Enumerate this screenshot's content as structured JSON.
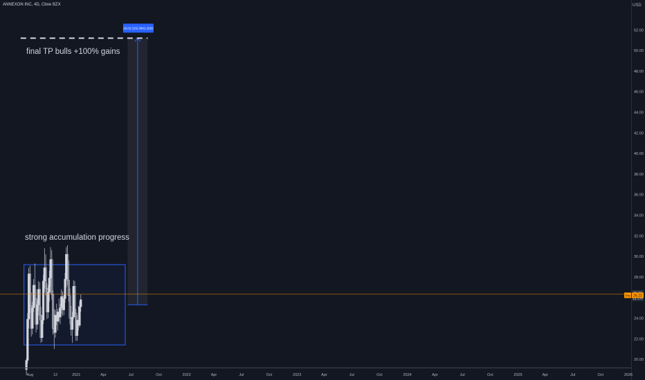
{
  "header": {
    "symbol_title": "ANNEXON INC, 4D, Cboe BZX",
    "currency": "USD"
  },
  "colors": {
    "background": "#131722",
    "candle": "#d1d4dc",
    "box_border": "#2962ff",
    "price_line": "#ff9800",
    "measure_fill": "rgba(120,123,134,0.15)",
    "measure_line": "#2962ff",
    "label_bg": "#2962ff",
    "target_line": "#d1d4dc"
  },
  "chart_data": {
    "type": "candlestick",
    "title": "",
    "xlabel": "",
    "ylabel": "",
    "x_ticks": [
      "Aug",
      "12",
      "2021",
      "Apr",
      "Jul",
      "Oct",
      "2022",
      "Apr",
      "Jul",
      "Oct",
      "2023",
      "Apr",
      "Jul",
      "Oct",
      "2024",
      "Apr",
      "Jul",
      "Oct",
      "2025",
      "Apr",
      "Jul",
      "Oct",
      "2026"
    ],
    "y_ticks": [
      20.0,
      22.0,
      24.0,
      26.0,
      28.0,
      30.0,
      32.0,
      34.0,
      36.0,
      38.0,
      40.0,
      42.0,
      44.0,
      46.0,
      48.0,
      50.0,
      52.0
    ],
    "ylim": [
      19.2,
      53.7
    ],
    "grid": false,
    "candles": [
      {
        "date": "2020-07-20",
        "o": 19.0,
        "h": 20.1,
        "l": 18.5,
        "c": 19.9
      },
      {
        "date": "2020-07-24",
        "o": 19.9,
        "h": 24.5,
        "l": 19.6,
        "c": 23.9
      },
      {
        "date": "2020-07-28",
        "o": 23.9,
        "h": 28.9,
        "l": 23.0,
        "c": 28.3
      },
      {
        "date": "2020-08-01",
        "o": 28.3,
        "h": 29.1,
        "l": 24.5,
        "c": 25.2
      },
      {
        "date": "2020-08-05",
        "o": 25.2,
        "h": 26.5,
        "l": 22.2,
        "c": 23.0
      },
      {
        "date": "2020-08-09",
        "o": 23.0,
        "h": 25.6,
        "l": 22.4,
        "c": 25.0
      },
      {
        "date": "2020-08-13",
        "o": 25.0,
        "h": 27.8,
        "l": 24.6,
        "c": 27.2
      },
      {
        "date": "2020-08-17",
        "o": 27.2,
        "h": 29.3,
        "l": 25.2,
        "c": 25.9
      },
      {
        "date": "2020-08-21",
        "o": 25.9,
        "h": 26.8,
        "l": 22.6,
        "c": 23.4
      },
      {
        "date": "2020-08-25",
        "o": 23.4,
        "h": 25.7,
        "l": 22.9,
        "c": 25.3
      },
      {
        "date": "2020-08-29",
        "o": 25.3,
        "h": 27.6,
        "l": 24.7,
        "c": 26.8
      },
      {
        "date": "2020-09-02",
        "o": 26.8,
        "h": 27.5,
        "l": 23.8,
        "c": 24.3
      },
      {
        "date": "2020-09-06",
        "o": 24.3,
        "h": 25.1,
        "l": 21.6,
        "c": 22.1
      },
      {
        "date": "2020-09-10",
        "o": 22.1,
        "h": 24.3,
        "l": 21.7,
        "c": 23.8
      },
      {
        "date": "2020-09-14",
        "o": 23.8,
        "h": 28.2,
        "l": 23.4,
        "c": 27.6
      },
      {
        "date": "2020-09-18",
        "o": 27.6,
        "h": 30.8,
        "l": 26.5,
        "c": 28.9
      },
      {
        "date": "2020-09-22",
        "o": 28.9,
        "h": 30.2,
        "l": 26.2,
        "c": 26.9
      },
      {
        "date": "2020-09-26",
        "o": 26.9,
        "h": 27.4,
        "l": 23.9,
        "c": 24.6
      },
      {
        "date": "2020-09-30",
        "o": 24.6,
        "h": 27.2,
        "l": 24.0,
        "c": 26.5
      },
      {
        "date": "2020-10-04",
        "o": 26.5,
        "h": 28.6,
        "l": 25.6,
        "c": 27.9
      },
      {
        "date": "2020-10-08",
        "o": 27.9,
        "h": 30.9,
        "l": 27.1,
        "c": 29.7
      },
      {
        "date": "2020-10-12",
        "o": 29.7,
        "h": 30.6,
        "l": 25.8,
        "c": 26.3
      },
      {
        "date": "2020-10-16",
        "o": 26.3,
        "h": 26.7,
        "l": 22.4,
        "c": 23.0
      },
      {
        "date": "2020-10-20",
        "o": 23.0,
        "h": 24.9,
        "l": 21.0,
        "c": 22.6
      },
      {
        "date": "2020-10-24",
        "o": 22.6,
        "h": 24.8,
        "l": 22.1,
        "c": 24.3
      },
      {
        "date": "2020-10-28",
        "o": 24.3,
        "h": 25.4,
        "l": 23.3,
        "c": 23.7
      },
      {
        "date": "2020-11-01",
        "o": 23.7,
        "h": 24.9,
        "l": 22.8,
        "c": 24.6
      },
      {
        "date": "2020-11-05",
        "o": 24.6,
        "h": 25.9,
        "l": 23.6,
        "c": 24.1
      },
      {
        "date": "2020-11-09",
        "o": 24.1,
        "h": 25.4,
        "l": 23.4,
        "c": 25.0
      },
      {
        "date": "2020-11-13",
        "o": 25.0,
        "h": 26.8,
        "l": 24.4,
        "c": 26.1
      },
      {
        "date": "2020-11-17",
        "o": 26.1,
        "h": 26.6,
        "l": 24.2,
        "c": 24.8
      },
      {
        "date": "2020-11-21",
        "o": 24.8,
        "h": 26.3,
        "l": 24.3,
        "c": 25.9
      },
      {
        "date": "2020-11-25",
        "o": 25.9,
        "h": 28.4,
        "l": 25.5,
        "c": 27.8
      },
      {
        "date": "2020-11-29",
        "o": 27.8,
        "h": 30.9,
        "l": 27.0,
        "c": 30.2
      },
      {
        "date": "2020-12-03",
        "o": 30.2,
        "h": 31.1,
        "l": 27.2,
        "c": 27.7
      },
      {
        "date": "2020-12-07",
        "o": 27.7,
        "h": 29.6,
        "l": 25.6,
        "c": 26.2
      },
      {
        "date": "2020-12-11",
        "o": 26.2,
        "h": 26.9,
        "l": 23.4,
        "c": 24.0
      },
      {
        "date": "2020-12-15",
        "o": 24.0,
        "h": 25.2,
        "l": 22.3,
        "c": 22.9
      },
      {
        "date": "2020-12-19",
        "o": 22.9,
        "h": 24.6,
        "l": 21.6,
        "c": 24.1
      },
      {
        "date": "2020-12-23",
        "o": 24.1,
        "h": 27.7,
        "l": 23.9,
        "c": 27.1
      },
      {
        "date": "2020-12-27",
        "o": 27.1,
        "h": 27.6,
        "l": 24.1,
        "c": 24.5
      },
      {
        "date": "2020-12-31",
        "o": 24.5,
        "h": 24.9,
        "l": 21.8,
        "c": 22.3
      },
      {
        "date": "2021-01-04",
        "o": 22.3,
        "h": 24.3,
        "l": 21.8,
        "c": 23.8
      },
      {
        "date": "2021-01-08",
        "o": 23.8,
        "h": 25.2,
        "l": 22.8,
        "c": 23.3
      },
      {
        "date": "2021-01-12",
        "o": 23.3,
        "h": 25.6,
        "l": 23.1,
        "c": 25.1
      },
      {
        "date": "2021-01-16",
        "o": 25.1,
        "h": 26.3,
        "l": 24.6,
        "c": 25.8
      }
    ],
    "price_levels": {
      "last_price": "26.33",
      "countdown": "1d 17h",
      "pre_label": "Pre",
      "pre_price": "26.22"
    },
    "annotations": {
      "target_text": "final TP bulls +100% gains",
      "accumulation_text": "strong accumulation progress",
      "target_price": 51.2,
      "accumulation_box": {
        "start": "2020-07-12",
        "end": "2021-06-12",
        "top": 29.2,
        "bottom": 21.4
      },
      "measure": {
        "start": "2021-06-20",
        "end": "2021-08-25",
        "from": 25.3,
        "to": 51.2,
        "label": "26.02 (102.36%) 2602"
      }
    }
  }
}
